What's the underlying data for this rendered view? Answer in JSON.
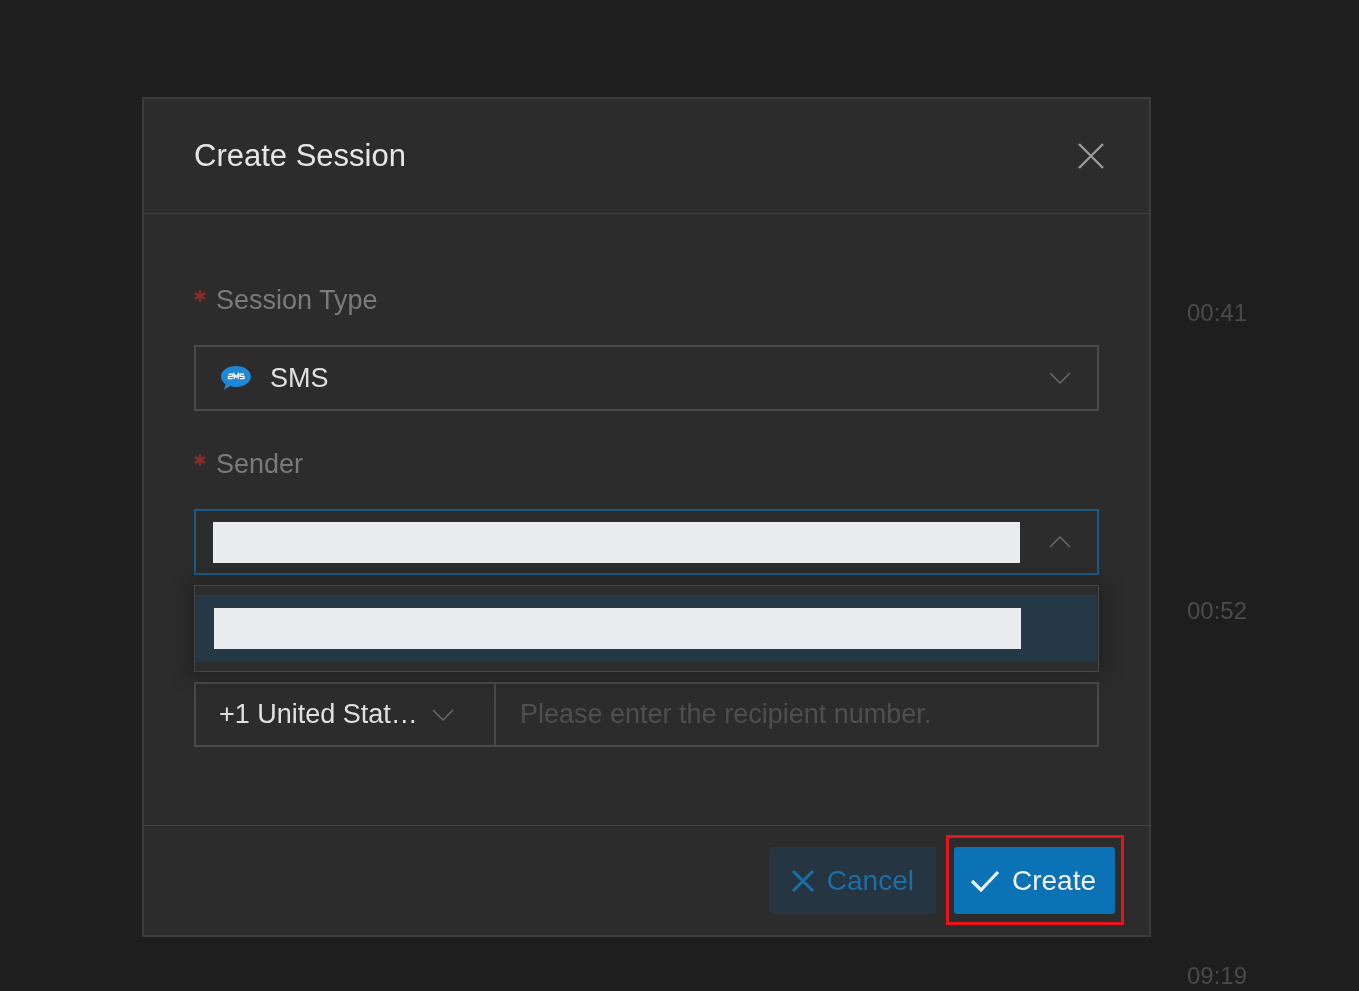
{
  "dialog": {
    "title": "Create Session",
    "fields": [
      {
        "kind": "select",
        "label": "Session Type",
        "required": true,
        "value": "SMS",
        "expanded": false
      },
      {
        "kind": "select",
        "label": "Sender",
        "required": true,
        "redacted": true,
        "expanded": true,
        "options": [
          {
            "redacted": true,
            "selected": true
          }
        ]
      },
      {
        "kind": "phone",
        "country": "+1 United Stat…",
        "placeholder": "Please enter the recipient number."
      }
    ],
    "buttons": [
      {
        "kind": "secondary",
        "label": "Cancel"
      },
      {
        "kind": "primary",
        "label": "Create",
        "highlighted": true
      }
    ]
  },
  "background": {
    "timestamps": [
      "00:41",
      "00:52",
      "09:19"
    ]
  }
}
